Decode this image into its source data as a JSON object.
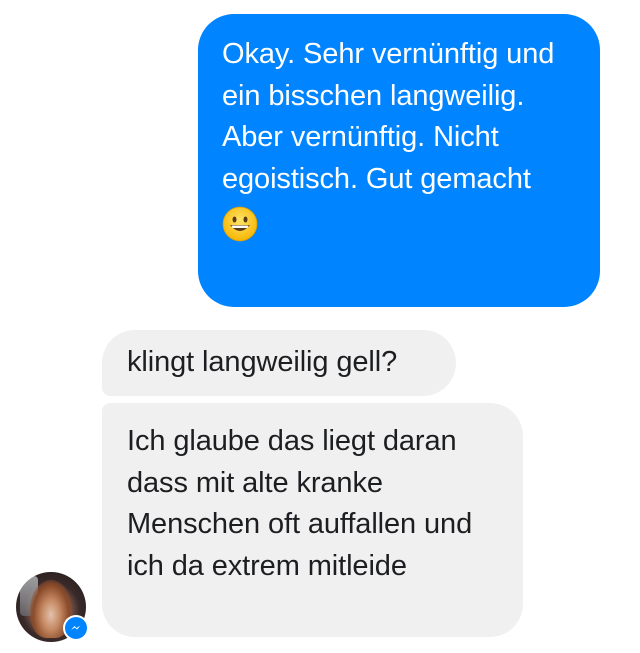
{
  "conversation": {
    "outgoing": {
      "text": "Okay. Sehr vernünftig und ein bisschen langweilig. Aber vernünftig. Nicht egoistisch. Gut gemacht",
      "emoji": "grinning-face-emoji"
    },
    "incoming": [
      {
        "text": "klingt langweilig gell?"
      },
      {
        "text": "Ich glaube das liegt daran dass mit alte kranke Menschen oft auffallen und ich da extrem mitleide"
      }
    ],
    "sender_avatar": "profile-photo",
    "badge_icon": "messenger-icon"
  },
  "colors": {
    "outgoing_bubble": "#0084ff",
    "incoming_bubble": "#f1f0f0",
    "outgoing_text": "#ffffff",
    "incoming_text": "#1c1e21"
  }
}
